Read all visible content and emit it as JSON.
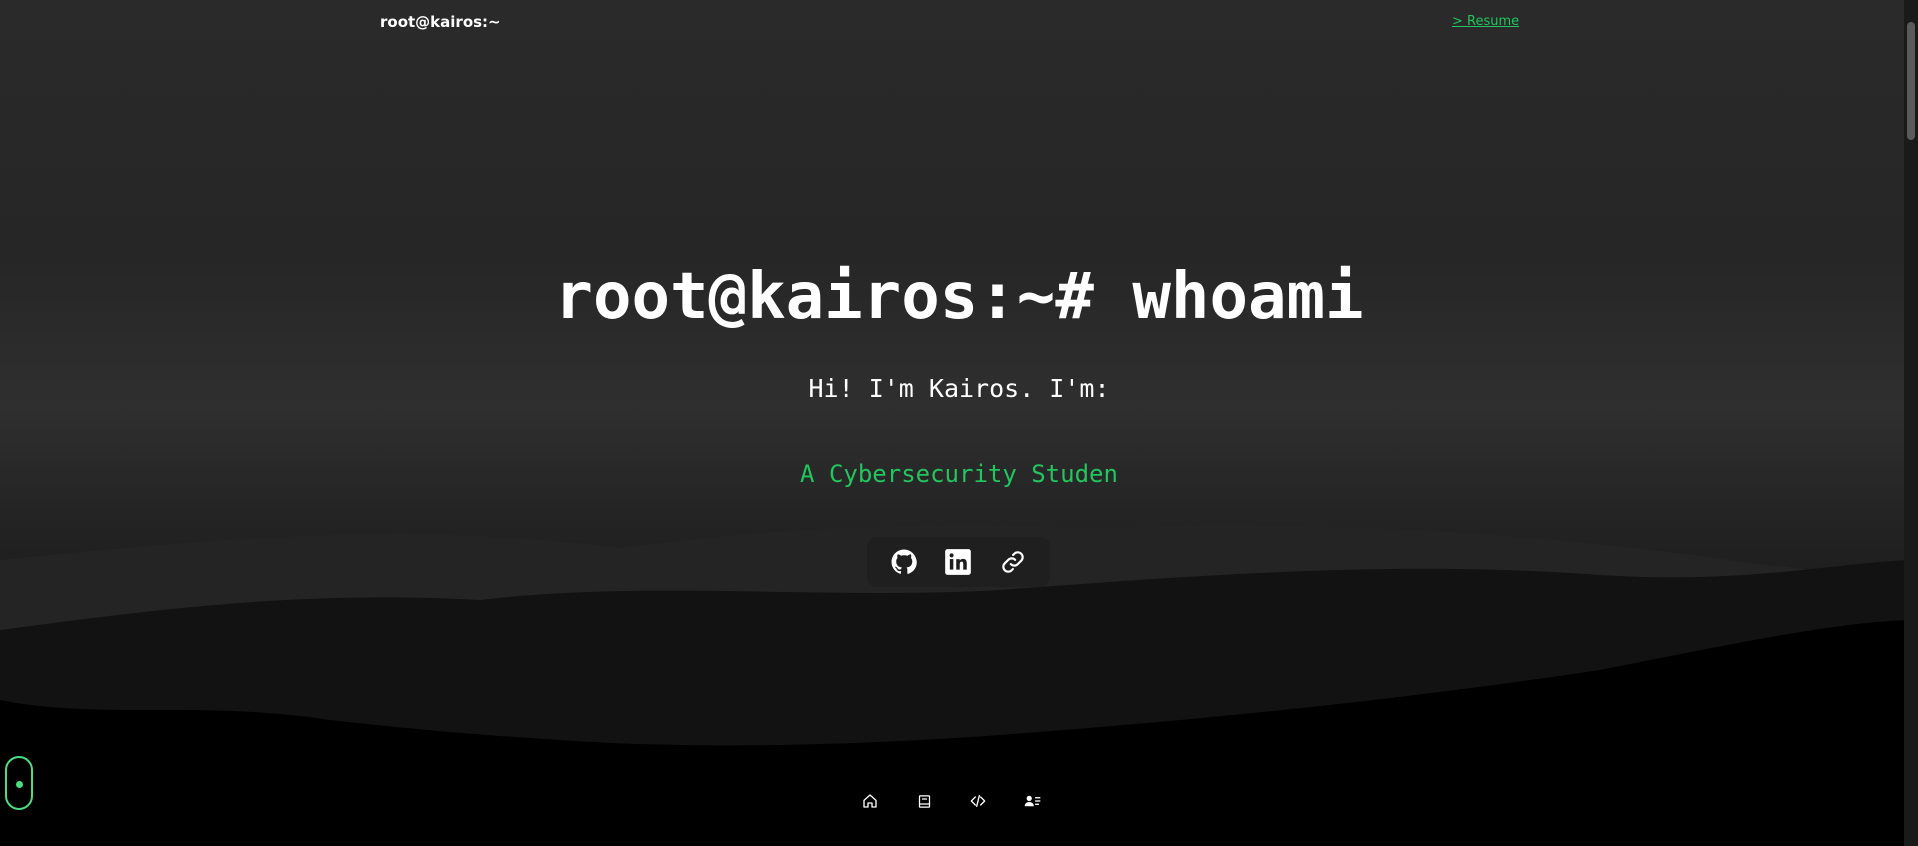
{
  "header": {
    "brand": "root@kairos:~",
    "resume_link": "> Resume"
  },
  "hero": {
    "title": "root@kairos:~# whoami",
    "subtitle": "Hi! I'm Kairos. I'm:",
    "role": "A Cybersecurity Studen"
  },
  "social": {
    "items": [
      {
        "icon": "github-icon"
      },
      {
        "icon": "linkedin-icon"
      },
      {
        "icon": "link-icon"
      }
    ]
  },
  "bottom_nav": {
    "items": [
      {
        "icon": "home-icon"
      },
      {
        "icon": "book-icon"
      },
      {
        "icon": "code-icon"
      },
      {
        "icon": "contact-icon"
      }
    ]
  },
  "colors": {
    "accent": "#22c55e",
    "background": "#000000",
    "text": "#ffffff"
  }
}
